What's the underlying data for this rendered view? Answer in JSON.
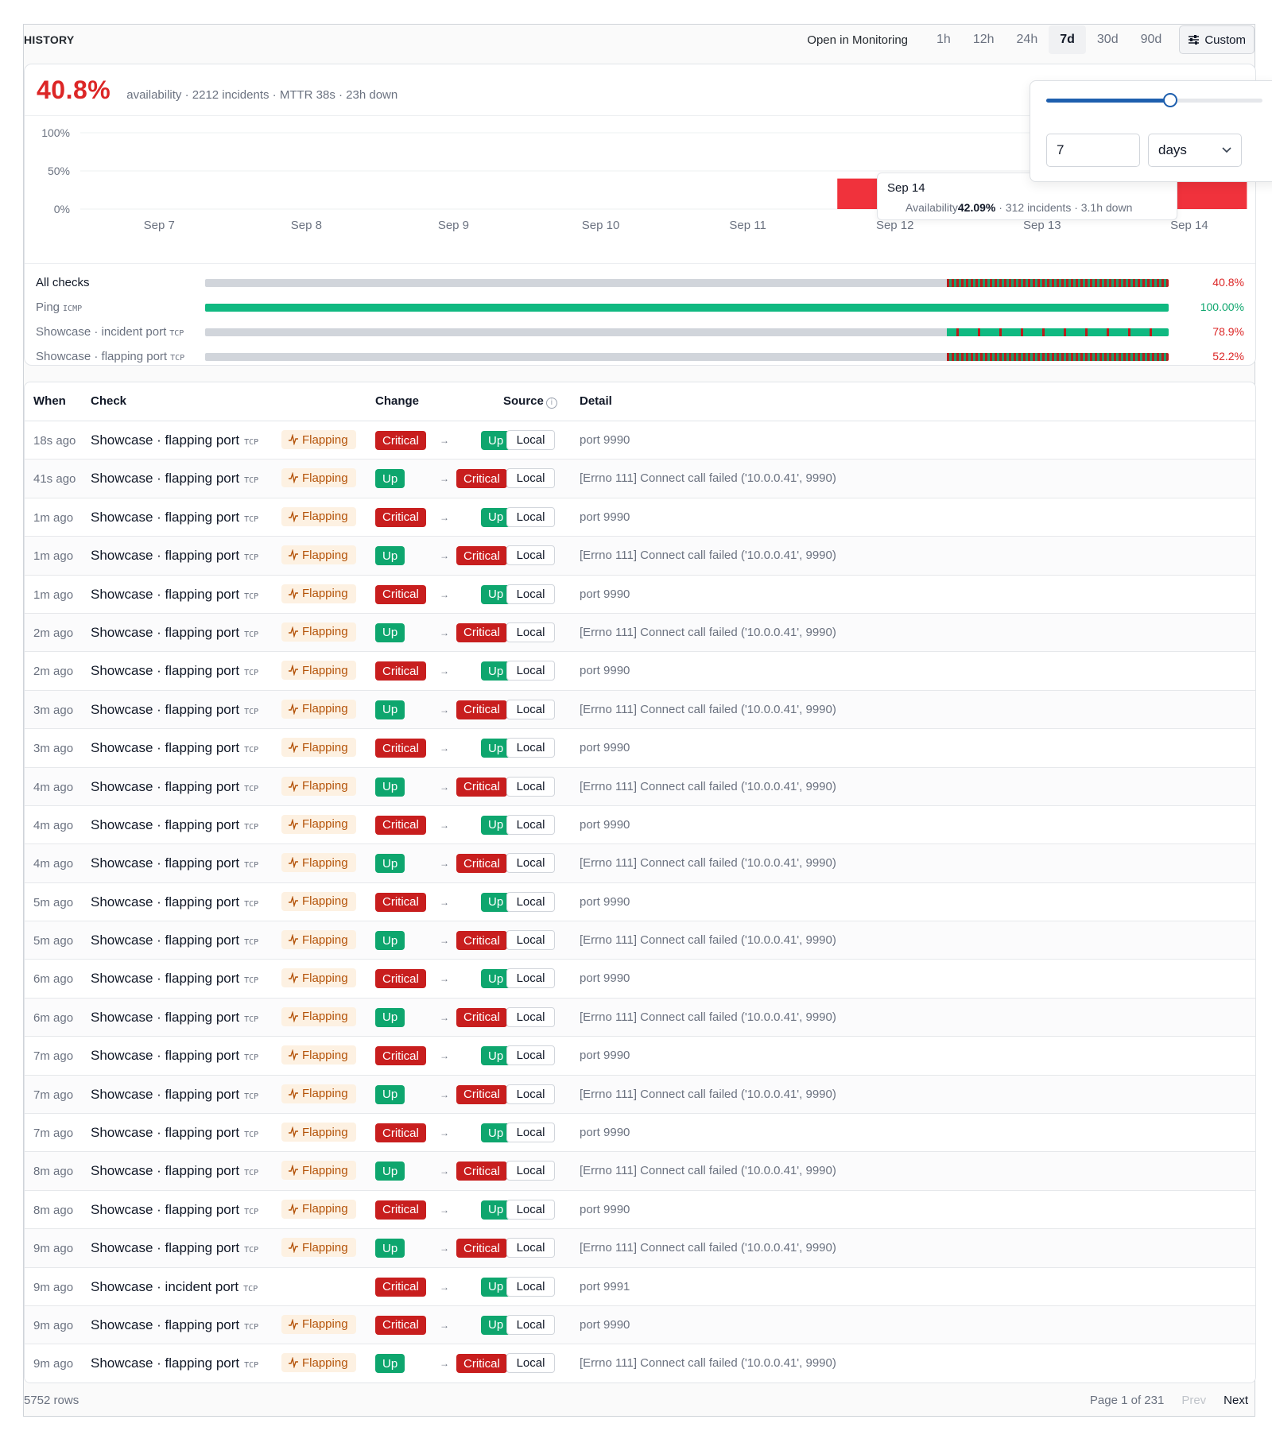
{
  "header": {
    "title": "HISTORY",
    "open_link": "Open in Monitoring",
    "ranges": [
      {
        "label": "1h",
        "active": false
      },
      {
        "label": "12h",
        "active": false
      },
      {
        "label": "24h",
        "active": false
      },
      {
        "label": "7d",
        "active": true
      },
      {
        "label": "30d",
        "active": false
      },
      {
        "label": "90d",
        "active": false
      }
    ],
    "custom_label": "Custom",
    "custom_icon": "sliders-icon"
  },
  "summary": {
    "availability": "40.8%",
    "text": "availability · 2212 incidents · MTTR 38s · 23h down"
  },
  "custom_range": {
    "slider_fraction": 0.575,
    "value": "7",
    "unit": "days"
  },
  "tooltip": {
    "date": "Sep 14",
    "label": "Availability",
    "value": "42.09%",
    "rest": " · 312 incidents · 3.1h down"
  },
  "chart_data": {
    "type": "bar",
    "categories": [
      "Sep 7",
      "Sep 8",
      "Sep 9",
      "Sep 10",
      "Sep 11",
      "Sep 12",
      "Sep 13",
      "Sep 14"
    ],
    "values": [
      null,
      null,
      null,
      null,
      null,
      40.0,
      40.5,
      42.09
    ],
    "y_ticks": [
      "100%",
      "50%",
      "0%"
    ],
    "ylim": [
      0,
      100
    ],
    "bar_color": "#f0323c",
    "grid": true
  },
  "checks": [
    {
      "name": "All checks",
      "proto": "",
      "pct": "40.8%",
      "pct_color": "#dc2626",
      "strong": true,
      "kind": "mixed",
      "data_start": 0.77
    },
    {
      "name": "Ping",
      "proto": "ICMP",
      "pct": "100.00%",
      "pct_color": "#0ea66e",
      "strong": false,
      "kind": "green",
      "data_start": 0.0
    },
    {
      "name": "Showcase · incident port",
      "proto": "TCP",
      "pct": "78.9%",
      "pct_color": "#dc2626",
      "strong": false,
      "kind": "mostly-green",
      "data_start": 0.77
    },
    {
      "name": "Showcase · flapping port",
      "proto": "TCP",
      "pct": "52.2%",
      "pct_color": "#dc2626",
      "strong": false,
      "kind": "mixed",
      "data_start": 0.77
    }
  ],
  "table": {
    "headers": {
      "when": "When",
      "check": "Check",
      "change": "Change",
      "source": "Source",
      "detail": "Detail"
    },
    "flapping_label": "Flapping",
    "flapping_icon": "activity-icon",
    "arrow": "→",
    "rows": [
      {
        "when": "18s ago",
        "check": "Showcase · flapping port",
        "proto": "TCP",
        "flapping": true,
        "from": "Critical",
        "to": "Up",
        "source": "Local",
        "detail": "port 9990"
      },
      {
        "when": "41s ago",
        "check": "Showcase · flapping port",
        "proto": "TCP",
        "flapping": true,
        "from": "Up",
        "to": "Critical",
        "source": "Local",
        "detail": "[Errno 111] Connect call failed ('10.0.0.41', 9990)"
      },
      {
        "when": "1m ago",
        "check": "Showcase · flapping port",
        "proto": "TCP",
        "flapping": true,
        "from": "Critical",
        "to": "Up",
        "source": "Local",
        "detail": "port 9990"
      },
      {
        "when": "1m ago",
        "check": "Showcase · flapping port",
        "proto": "TCP",
        "flapping": true,
        "from": "Up",
        "to": "Critical",
        "source": "Local",
        "detail": "[Errno 111] Connect call failed ('10.0.0.41', 9990)"
      },
      {
        "when": "1m ago",
        "check": "Showcase · flapping port",
        "proto": "TCP",
        "flapping": true,
        "from": "Critical",
        "to": "Up",
        "source": "Local",
        "detail": "port 9990"
      },
      {
        "when": "2m ago",
        "check": "Showcase · flapping port",
        "proto": "TCP",
        "flapping": true,
        "from": "Up",
        "to": "Critical",
        "source": "Local",
        "detail": "[Errno 111] Connect call failed ('10.0.0.41', 9990)"
      },
      {
        "when": "2m ago",
        "check": "Showcase · flapping port",
        "proto": "TCP",
        "flapping": true,
        "from": "Critical",
        "to": "Up",
        "source": "Local",
        "detail": "port 9990"
      },
      {
        "when": "3m ago",
        "check": "Showcase · flapping port",
        "proto": "TCP",
        "flapping": true,
        "from": "Up",
        "to": "Critical",
        "source": "Local",
        "detail": "[Errno 111] Connect call failed ('10.0.0.41', 9990)"
      },
      {
        "when": "3m ago",
        "check": "Showcase · flapping port",
        "proto": "TCP",
        "flapping": true,
        "from": "Critical",
        "to": "Up",
        "source": "Local",
        "detail": "port 9990"
      },
      {
        "when": "4m ago",
        "check": "Showcase · flapping port",
        "proto": "TCP",
        "flapping": true,
        "from": "Up",
        "to": "Critical",
        "source": "Local",
        "detail": "[Errno 111] Connect call failed ('10.0.0.41', 9990)"
      },
      {
        "when": "4m ago",
        "check": "Showcase · flapping port",
        "proto": "TCP",
        "flapping": true,
        "from": "Critical",
        "to": "Up",
        "source": "Local",
        "detail": "port 9990"
      },
      {
        "when": "4m ago",
        "check": "Showcase · flapping port",
        "proto": "TCP",
        "flapping": true,
        "from": "Up",
        "to": "Critical",
        "source": "Local",
        "detail": "[Errno 111] Connect call failed ('10.0.0.41', 9990)"
      },
      {
        "when": "5m ago",
        "check": "Showcase · flapping port",
        "proto": "TCP",
        "flapping": true,
        "from": "Critical",
        "to": "Up",
        "source": "Local",
        "detail": "port 9990"
      },
      {
        "when": "5m ago",
        "check": "Showcase · flapping port",
        "proto": "TCP",
        "flapping": true,
        "from": "Up",
        "to": "Critical",
        "source": "Local",
        "detail": "[Errno 111] Connect call failed ('10.0.0.41', 9990)"
      },
      {
        "when": "6m ago",
        "check": "Showcase · flapping port",
        "proto": "TCP",
        "flapping": true,
        "from": "Critical",
        "to": "Up",
        "source": "Local",
        "detail": "port 9990"
      },
      {
        "when": "6m ago",
        "check": "Showcase · flapping port",
        "proto": "TCP",
        "flapping": true,
        "from": "Up",
        "to": "Critical",
        "source": "Local",
        "detail": "[Errno 111] Connect call failed ('10.0.0.41', 9990)"
      },
      {
        "when": "7m ago",
        "check": "Showcase · flapping port",
        "proto": "TCP",
        "flapping": true,
        "from": "Critical",
        "to": "Up",
        "source": "Local",
        "detail": "port 9990"
      },
      {
        "when": "7m ago",
        "check": "Showcase · flapping port",
        "proto": "TCP",
        "flapping": true,
        "from": "Up",
        "to": "Critical",
        "source": "Local",
        "detail": "[Errno 111] Connect call failed ('10.0.0.41', 9990)"
      },
      {
        "when": "7m ago",
        "check": "Showcase · flapping port",
        "proto": "TCP",
        "flapping": true,
        "from": "Critical",
        "to": "Up",
        "source": "Local",
        "detail": "port 9990"
      },
      {
        "when": "8m ago",
        "check": "Showcase · flapping port",
        "proto": "TCP",
        "flapping": true,
        "from": "Up",
        "to": "Critical",
        "source": "Local",
        "detail": "[Errno 111] Connect call failed ('10.0.0.41', 9990)"
      },
      {
        "when": "8m ago",
        "check": "Showcase · flapping port",
        "proto": "TCP",
        "flapping": true,
        "from": "Critical",
        "to": "Up",
        "source": "Local",
        "detail": "port 9990"
      },
      {
        "when": "9m ago",
        "check": "Showcase · flapping port",
        "proto": "TCP",
        "flapping": true,
        "from": "Up",
        "to": "Critical",
        "source": "Local",
        "detail": "[Errno 111] Connect call failed ('10.0.0.41', 9990)"
      },
      {
        "when": "9m ago",
        "check": "Showcase · incident port",
        "proto": "TCP",
        "flapping": false,
        "from": "Critical",
        "to": "Up",
        "source": "Local",
        "detail": "port 9991"
      },
      {
        "when": "9m ago",
        "check": "Showcase · flapping port",
        "proto": "TCP",
        "flapping": true,
        "from": "Critical",
        "to": "Up",
        "source": "Local",
        "detail": "port 9990"
      },
      {
        "when": "9m ago",
        "check": "Showcase · flapping port",
        "proto": "TCP",
        "flapping": true,
        "from": "Up",
        "to": "Critical",
        "source": "Local",
        "detail": "[Errno 111] Connect call failed ('10.0.0.41', 9990)"
      }
    ]
  },
  "footer": {
    "rows": "5752 rows",
    "page": "Page 1 of 231",
    "prev": "Prev",
    "next": "Next"
  }
}
